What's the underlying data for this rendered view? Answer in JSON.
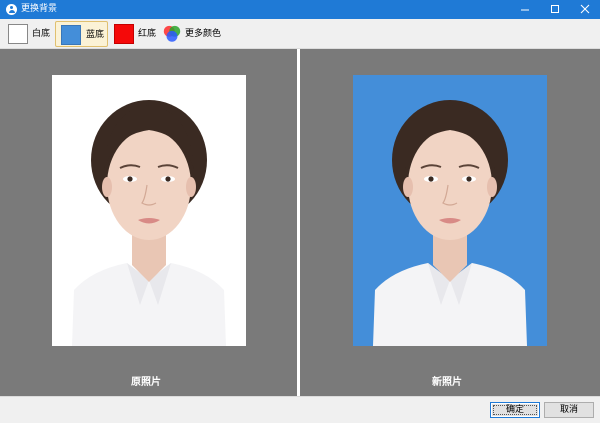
{
  "window": {
    "title": "更换背景"
  },
  "toolbar": {
    "items": [
      {
        "label": "白底",
        "color": "#ffffff"
      },
      {
        "label": "蓝底",
        "color": "#448ed9",
        "selected": true
      },
      {
        "label": "红底",
        "color": "#f50909"
      },
      {
        "label": "更多颜色",
        "icon": "color-wheel-icon"
      }
    ]
  },
  "panels": {
    "original_caption": "原照片",
    "new_caption": "新照片",
    "original_bg": "#ffffff",
    "new_bg": "#448ed9"
  },
  "buttons": {
    "ok_label": "确定",
    "cancel_label": "取消"
  }
}
